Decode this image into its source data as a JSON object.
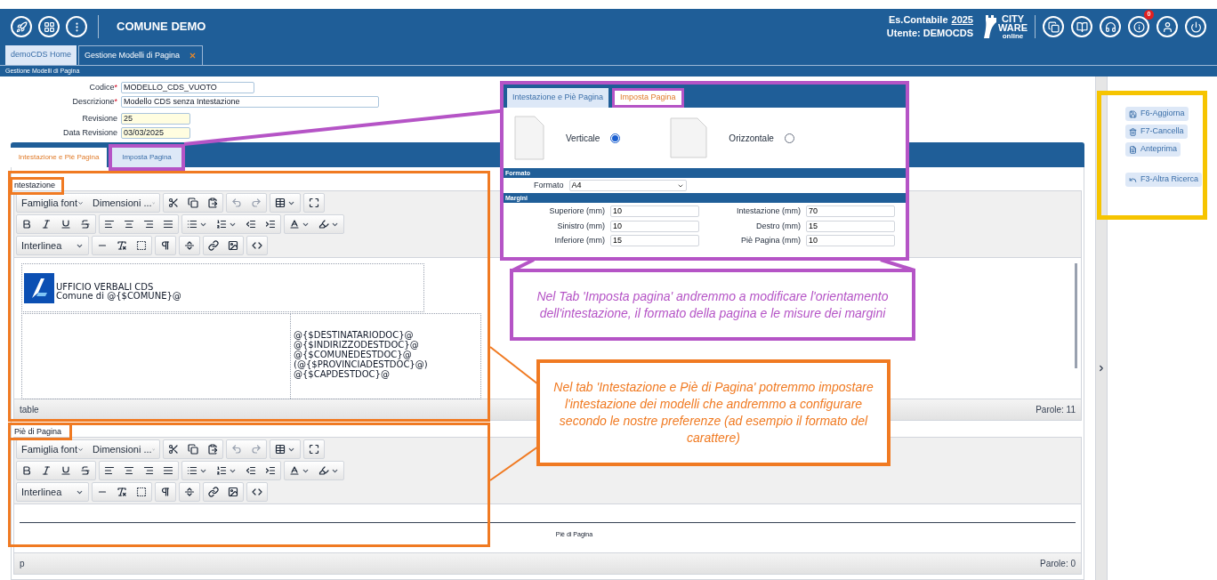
{
  "header": {
    "title": "COMUNE DEMO",
    "exercise_label": "Es.Contabile",
    "exercise_year": "2025",
    "user": "Utente: DEMOCDS",
    "logo": {
      "line1": "CITY",
      "line2": "WARE",
      "tagline": "online"
    },
    "info_badge": "0"
  },
  "app_tabs": [
    {
      "label": "demoCDS Home",
      "selected": false,
      "closable": false
    },
    {
      "label": "Gestione Modelli di Pagina",
      "selected": true,
      "closable": true
    }
  ],
  "breadcrumb": "Gestione Modelli di Pagina",
  "form": [
    {
      "label": "Codice",
      "mark": "*",
      "value": "MODELLO_CDS_VUOTO",
      "readonly": false
    },
    {
      "label": "Descrizione",
      "mark": "*",
      "value": "Modello CDS senza Intestazione",
      "readonly": false
    },
    {
      "label": "Revisione",
      "value": "25",
      "readonly": true
    },
    {
      "label": "Data Revisione",
      "value": "03/03/2025",
      "readonly": true
    }
  ],
  "form_tabs": [
    {
      "label": "Intestazione e Piè Pagina",
      "selected": true
    },
    {
      "label": "Imposta Pagina",
      "selected": false
    }
  ],
  "editors": [
    {
      "label": "ntestazione",
      "font_family": "Famiglia font",
      "font_size": "Dimensioni ...",
      "line_height": "Interlinea",
      "history_disabled": true,
      "kind": "header",
      "header_lines": [
        "UFFICIO VERBALI CDS",
        "Comune di @{$COMUNE}@"
      ],
      "address_lines": [
        "@{$DESTINATARIODOC}@",
        "@{$INDIRIZZODESTDOC}@",
        "@{$COMUNEDESTDOC}@",
        "(@{$PROVINCIADESTDOC}@)",
        "@{$CAPDESTDOC}@"
      ],
      "path": "table",
      "word_count": "Parole: 11"
    },
    {
      "label": "Piè di Pagina",
      "font_family": "Famiglia font",
      "font_size": "Dimensioni ...",
      "line_height": "Interlinea",
      "history_disabled": true,
      "kind": "footer",
      "footer_text": "Piè di Pagina",
      "path": "p",
      "word_count": "Parole: 0"
    }
  ],
  "actions": [
    {
      "label": "F6-Aggiorna",
      "kind": "save"
    },
    {
      "label": "F7-Cancella",
      "kind": "delete"
    },
    {
      "label": "Anteprima",
      "kind": "preview"
    },
    {
      "label": "F3-Altra Ricerca",
      "kind": "back"
    }
  ],
  "inset": {
    "tabs": [
      {
        "label": "Intestazione e Piè Pagina",
        "selected": false
      },
      {
        "label": "Imposta Pagina",
        "selected": true
      }
    ],
    "orientations": [
      {
        "label": "Verticale",
        "selected": true,
        "kind": "portrait"
      },
      {
        "label": "Orizzontale",
        "selected": false,
        "kind": "landscape"
      }
    ],
    "format_section": "Formato",
    "format_label": "Formato",
    "format_value": "A4",
    "margins_section": "Margini",
    "margins": [
      {
        "label": "Superiore (mm)",
        "value": "10"
      },
      {
        "label": "Intestazione (mm)",
        "value": "70"
      },
      {
        "label": "Sinistro (mm)",
        "value": "10"
      },
      {
        "label": "Destro (mm)",
        "value": "15"
      },
      {
        "label": "Inferiore (mm)",
        "value": "15"
      },
      {
        "label": "Piè Pagina (mm)",
        "value": "10"
      }
    ]
  },
  "callouts": [
    {
      "kind": "purple",
      "text": "Nel Tab 'Imposta pagina' andremmo a modificare l'orientamento dell'intestazione, il formato della pagina e le misure dei margini"
    },
    {
      "kind": "orange",
      "text": "Nel tab 'Intestazione e Piè di Pagina' potremmo impostare l'intestazione dei modelli che andremmo a configurare secondo le nostre preferenze (ad esempio il formato del carattere)"
    }
  ]
}
